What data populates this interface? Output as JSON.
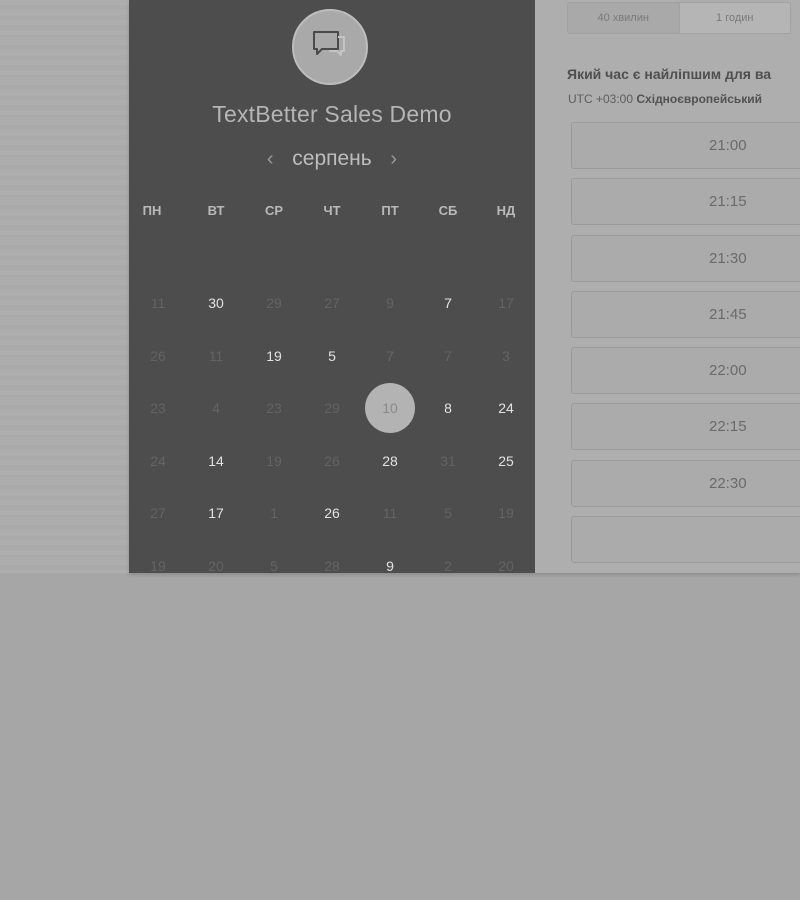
{
  "event": {
    "title": "TextBetter Sales Demo",
    "logo_icon": "chat-bubble-icon"
  },
  "calendar": {
    "month": "серпень",
    "prev_icon": "chevron-left-icon",
    "next_icon": "chevron-right-icon",
    "weekdays": [
      "ПН",
      "ВТ",
      "СР",
      "ЧТ",
      "ПТ",
      "СБ",
      "НД"
    ],
    "weeks": [
      [
        {
          "d": "11",
          "avail": false
        },
        {
          "d": "30",
          "avail": true
        },
        {
          "d": "29",
          "avail": false
        },
        {
          "d": "27",
          "avail": false
        },
        {
          "d": "9",
          "avail": false
        },
        {
          "d": "7",
          "avail": true
        },
        {
          "d": "17",
          "avail": false
        }
      ],
      [
        {
          "d": "26",
          "avail": false
        },
        {
          "d": "11",
          "avail": false
        },
        {
          "d": "19",
          "avail": true
        },
        {
          "d": "5",
          "avail": true
        },
        {
          "d": "7",
          "avail": false
        },
        {
          "d": "7",
          "avail": false
        },
        {
          "d": "3",
          "avail": false
        }
      ],
      [
        {
          "d": "23",
          "avail": false
        },
        {
          "d": "4",
          "avail": false
        },
        {
          "d": "23",
          "avail": false
        },
        {
          "d": "29",
          "avail": false
        },
        {
          "d": "10",
          "avail": true,
          "selected": true
        },
        {
          "d": "8",
          "avail": true
        },
        {
          "d": "24",
          "avail": true
        }
      ],
      [
        {
          "d": "24",
          "avail": false
        },
        {
          "d": "14",
          "avail": true
        },
        {
          "d": "19",
          "avail": false
        },
        {
          "d": "26",
          "avail": false
        },
        {
          "d": "28",
          "avail": true
        },
        {
          "d": "31",
          "avail": false
        },
        {
          "d": "25",
          "avail": true
        }
      ],
      [
        {
          "d": "27",
          "avail": false
        },
        {
          "d": "17",
          "avail": true
        },
        {
          "d": "1",
          "avail": false
        },
        {
          "d": "26",
          "avail": true
        },
        {
          "d": "11",
          "avail": false
        },
        {
          "d": "5",
          "avail": false
        },
        {
          "d": "19",
          "avail": false
        }
      ],
      [
        {
          "d": "19",
          "avail": false
        },
        {
          "d": "20",
          "avail": false
        },
        {
          "d": "5",
          "avail": false
        },
        {
          "d": "28",
          "avail": false
        },
        {
          "d": "9",
          "avail": true
        },
        {
          "d": "2",
          "avail": false
        },
        {
          "d": "20",
          "avail": false
        }
      ]
    ]
  },
  "durations": [
    {
      "label": "40 хвилин",
      "active": true
    },
    {
      "label": "1 годин",
      "active": false
    }
  ],
  "booking": {
    "question": "Який час є найліпшим для ва",
    "tz_offset": "UTC +03:00",
    "tz_name": "Східноєвропейський"
  },
  "slots": [
    "21:00",
    "21:15",
    "21:30",
    "21:45",
    "22:00",
    "22:15",
    "22:30",
    ""
  ]
}
